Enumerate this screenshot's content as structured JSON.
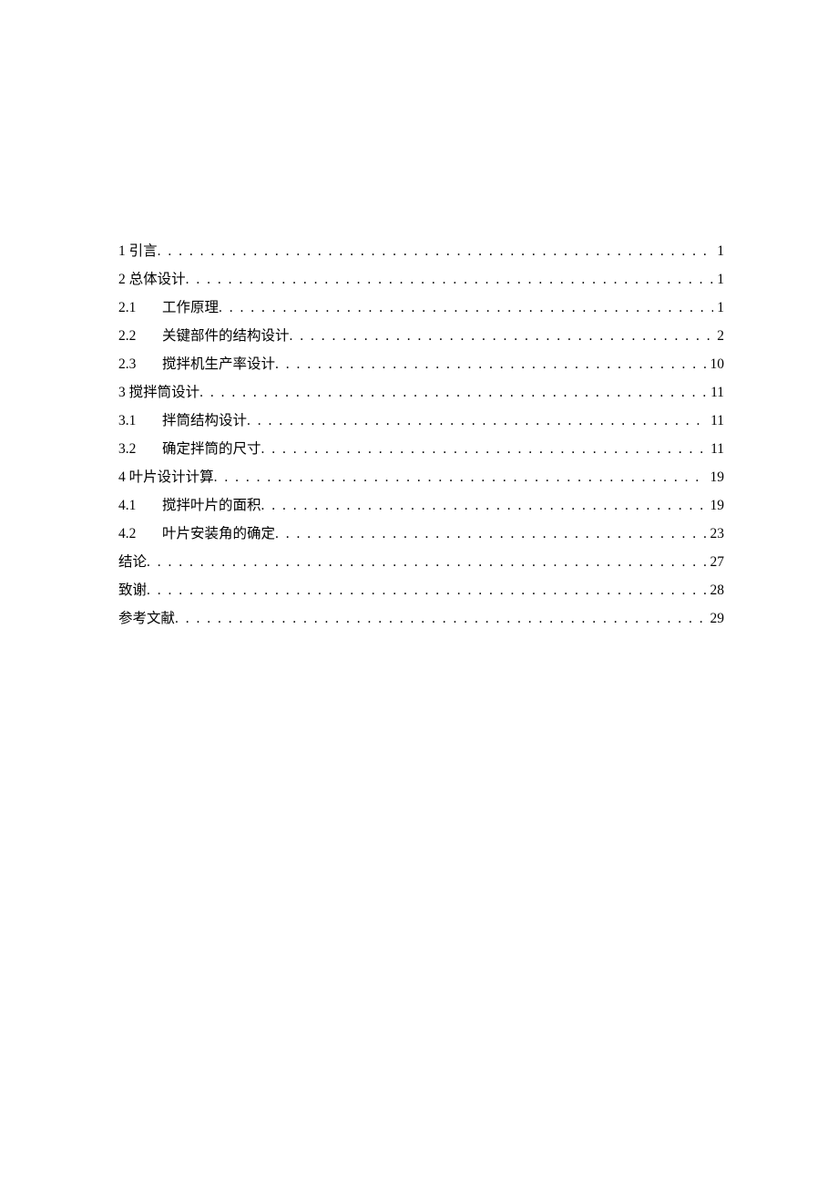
{
  "toc": [
    {
      "num": "1",
      "title": "引言",
      "page": "1",
      "nested": false
    },
    {
      "num": "2",
      "title": "总体设计",
      "page": "1",
      "nested": false
    },
    {
      "num": "2.1",
      "title": "工作原理",
      "page": "1",
      "nested": true
    },
    {
      "num": "2.2",
      "title": "关键部件的结构设计",
      "page": "2",
      "nested": true
    },
    {
      "num": "2.3",
      "title": "搅拌机生产率设计",
      "page": "10",
      "nested": true
    },
    {
      "num": "3",
      "title": "搅拌筒设计",
      "page": "11",
      "nested": false
    },
    {
      "num": "3.1",
      "title": "拌筒结构设计",
      "page": "11",
      "nested": true
    },
    {
      "num": "3.2",
      "title": "确定拌筒的尺寸",
      "page": "11",
      "nested": true
    },
    {
      "num": "4",
      "title": "叶片设计计算",
      "page": "19",
      "nested": false
    },
    {
      "num": "4.1",
      "title": "搅拌叶片的面积",
      "page": "19",
      "nested": true
    },
    {
      "num": "4.2",
      "title": "叶片安装角的确定",
      "page": "23",
      "nested": true
    },
    {
      "num": "",
      "title": "结论",
      "page": "27",
      "nested": false
    },
    {
      "num": "",
      "title": "致谢",
      "page": "28",
      "nested": false
    },
    {
      "num": "",
      "title": "参考文献",
      "page": "29",
      "nested": false
    }
  ]
}
